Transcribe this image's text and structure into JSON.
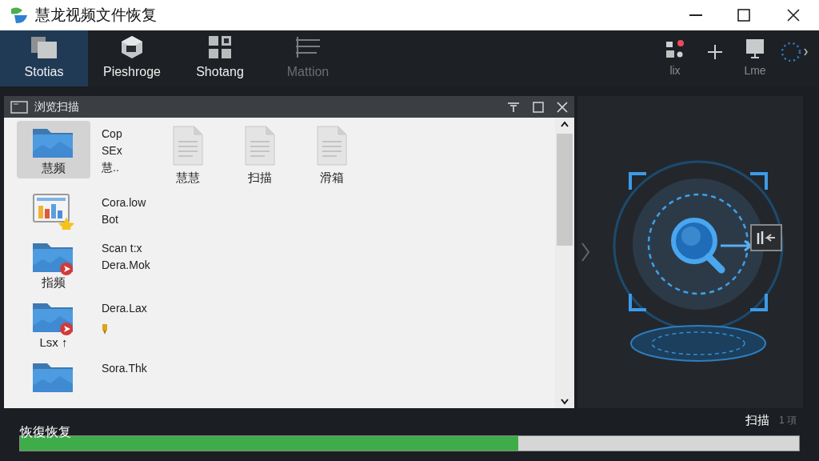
{
  "window": {
    "title": "慧龙视频文件恢复"
  },
  "toolbar": {
    "tabs": [
      {
        "label": "Stotias",
        "selected": true,
        "kind": "folders"
      },
      {
        "label": "Pieshroge",
        "selected": false,
        "kind": "cube"
      },
      {
        "label": "Shotang",
        "selected": false,
        "kind": "grid"
      },
      {
        "label": "Mattion",
        "selected": false,
        "disabled": true,
        "kind": "list"
      }
    ],
    "tools": [
      {
        "label": "lix",
        "kind": "shapes"
      },
      {
        "kind": "plus"
      },
      {
        "label": "Lme",
        "kind": "monitor"
      },
      {
        "kind": "spinner"
      }
    ]
  },
  "browser": {
    "title": "浏览扫描",
    "rows": [
      {
        "tile": {
          "kind": "folder",
          "label": "慧频",
          "selected": true,
          "badge": false
        },
        "lines": [
          "Cop",
          "SEx",
          "慧.."
        ],
        "docs": [
          "慧慧",
          "扫描",
          "滑箱"
        ]
      },
      {
        "tile": {
          "kind": "chart",
          "selected": false
        },
        "lines": [
          "Cora.low",
          "Bot"
        ]
      },
      {
        "tile": {
          "kind": "folder",
          "label": "指频",
          "selected": false,
          "badge": true
        },
        "lines": [
          "Scan t:x",
          "Dera.Mok"
        ]
      },
      {
        "tile": {
          "kind": "folder",
          "label": "Lsx ↑",
          "selected": false,
          "badge": true
        },
        "lines": [
          "Dera.Lax"
        ],
        "pen": true
      },
      {
        "tile": {
          "kind": "folder",
          "selected": false,
          "badge": false
        },
        "lines": [
          "Sora.Thk"
        ]
      }
    ]
  },
  "status": {
    "label": "扫描",
    "count": "1 項"
  },
  "progress": {
    "label": "恢復恢复",
    "level": 0.64
  }
}
